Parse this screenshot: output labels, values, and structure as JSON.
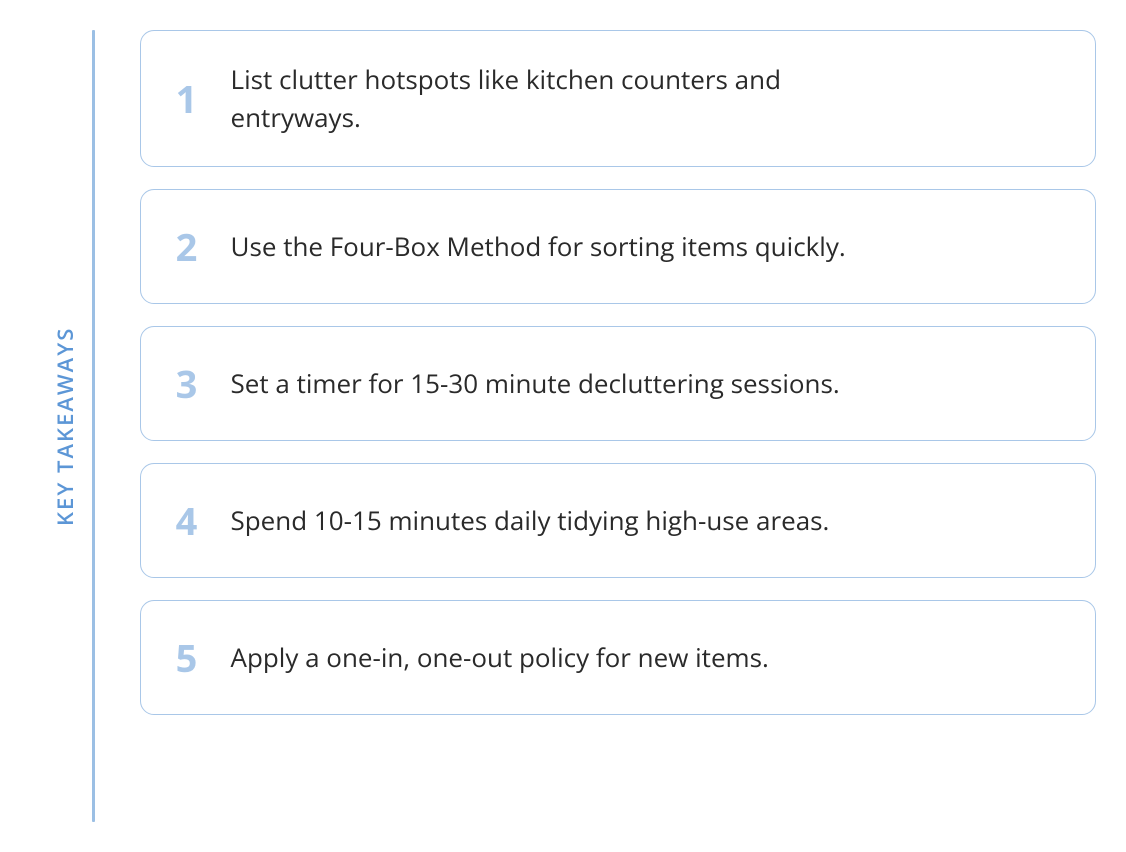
{
  "title": "KEY TAKEAWAYS",
  "items": [
    {
      "number": "1",
      "text": "List clutter hotspots like kitchen counters and entryways."
    },
    {
      "number": "2",
      "text": "Use the Four-Box Method for sorting items quickly."
    },
    {
      "number": "3",
      "text": "Set a timer for 15-30 minute decluttering sessions."
    },
    {
      "number": "4",
      "text": "Spend 10-15 minutes daily tidying high-use areas."
    },
    {
      "number": "5",
      "text": "Apply a one-in, one-out policy for new items."
    }
  ]
}
